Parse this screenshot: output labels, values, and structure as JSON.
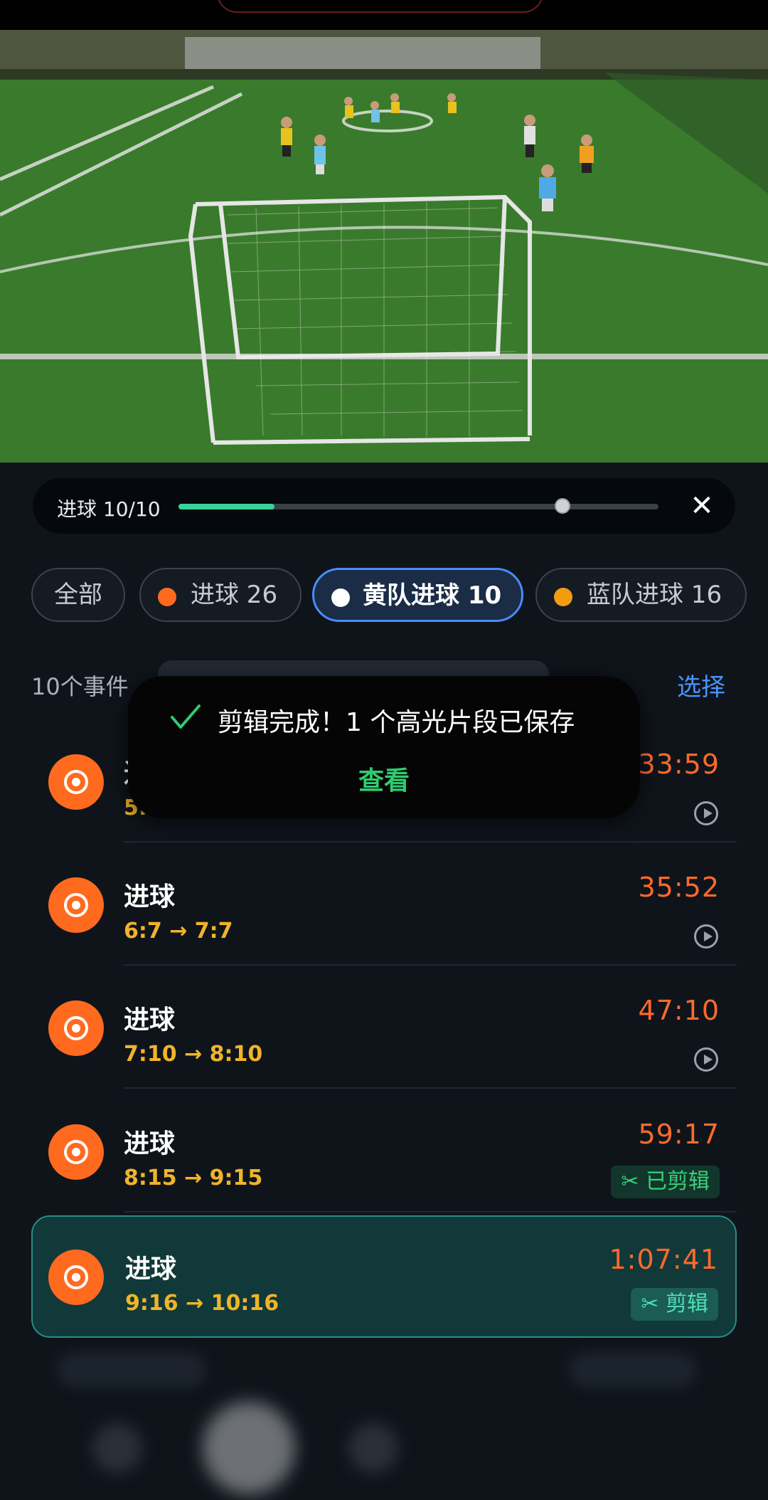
{
  "video": {
    "progress_label": "进球 10/10",
    "progress_fraction": 0.2,
    "playhead_fraction": 0.8
  },
  "filters": [
    {
      "label": "全部",
      "dot_color": ""
    },
    {
      "label": "进球 26",
      "dot_color": "#ff6a1f"
    },
    {
      "label": "黄队进球 10",
      "dot_color": "#ffffff",
      "active": true
    },
    {
      "label": "蓝队进球 16",
      "dot_color": "#f39c12"
    }
  ],
  "list_header": {
    "count": "10个事件",
    "select": "选择"
  },
  "events": [
    {
      "title": "进球",
      "score": "5:…",
      "time": "33:59",
      "status": "play"
    },
    {
      "title": "进球",
      "score": "6:7 → 7:7",
      "time": "35:52",
      "status": "play"
    },
    {
      "title": "进球",
      "score": "7:10 → 8:10",
      "time": "47:10",
      "status": "play"
    },
    {
      "title": "进球",
      "score": "8:15 → 9:15",
      "time": "59:17",
      "status": "clipped",
      "badge": "已剪辑"
    },
    {
      "title": "进球",
      "score": "9:16 → 10:16",
      "time": "1:07:41",
      "status": "clip",
      "badge": "剪辑",
      "selected": true
    }
  ],
  "toast": {
    "message": "剪辑完成！1 个高光片段已保存",
    "action": "查看"
  },
  "colors": {
    "accent_green": "#36d399",
    "accent_orange": "#ff6a1f",
    "select_blue": "#4a94ff",
    "score_yellow": "#f0b429"
  }
}
